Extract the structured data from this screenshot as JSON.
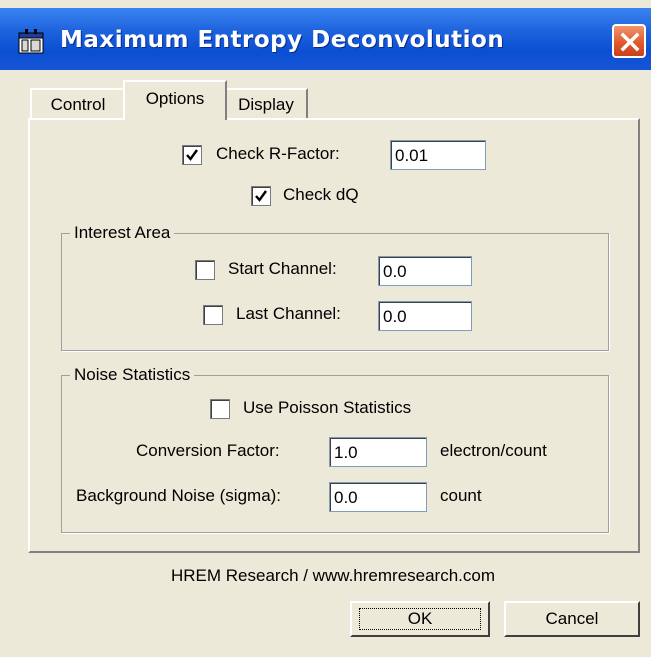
{
  "window": {
    "title": "Maximum Entropy Deconvolution",
    "icon": "app-window-icon",
    "close_icon": "close-icon"
  },
  "tabs": [
    {
      "label": "Control",
      "active": false
    },
    {
      "label": "Options",
      "active": true
    },
    {
      "label": "Display",
      "active": false
    }
  ],
  "options": {
    "check_r_factor": {
      "label": "Check R-Factor:",
      "checked": true,
      "value": "0.01"
    },
    "check_dq": {
      "label": "Check dQ",
      "checked": true
    }
  },
  "interest_area": {
    "title": "Interest Area",
    "start_channel": {
      "label": "Start Channel:",
      "checked": false,
      "value": "0.0"
    },
    "last_channel": {
      "label": "Last Channel:",
      "checked": false,
      "value": "0.0"
    }
  },
  "noise_statistics": {
    "title": "Noise Statistics",
    "use_poisson": {
      "label": "Use Poisson Statistics",
      "checked": false
    },
    "conversion_factor": {
      "label": "Conversion Factor:",
      "value": "1.0",
      "unit": "electron/count"
    },
    "background_noise": {
      "label": "Background Noise (sigma):",
      "value": "0.0",
      "unit": "count"
    }
  },
  "footer": {
    "text": "HREM Research / www.hremresearch.com"
  },
  "buttons": {
    "ok": "OK",
    "cancel": "Cancel"
  },
  "colors": {
    "titlebar": "#0a4fd3",
    "close": "#e05a2e",
    "face": "#ece9d8"
  }
}
